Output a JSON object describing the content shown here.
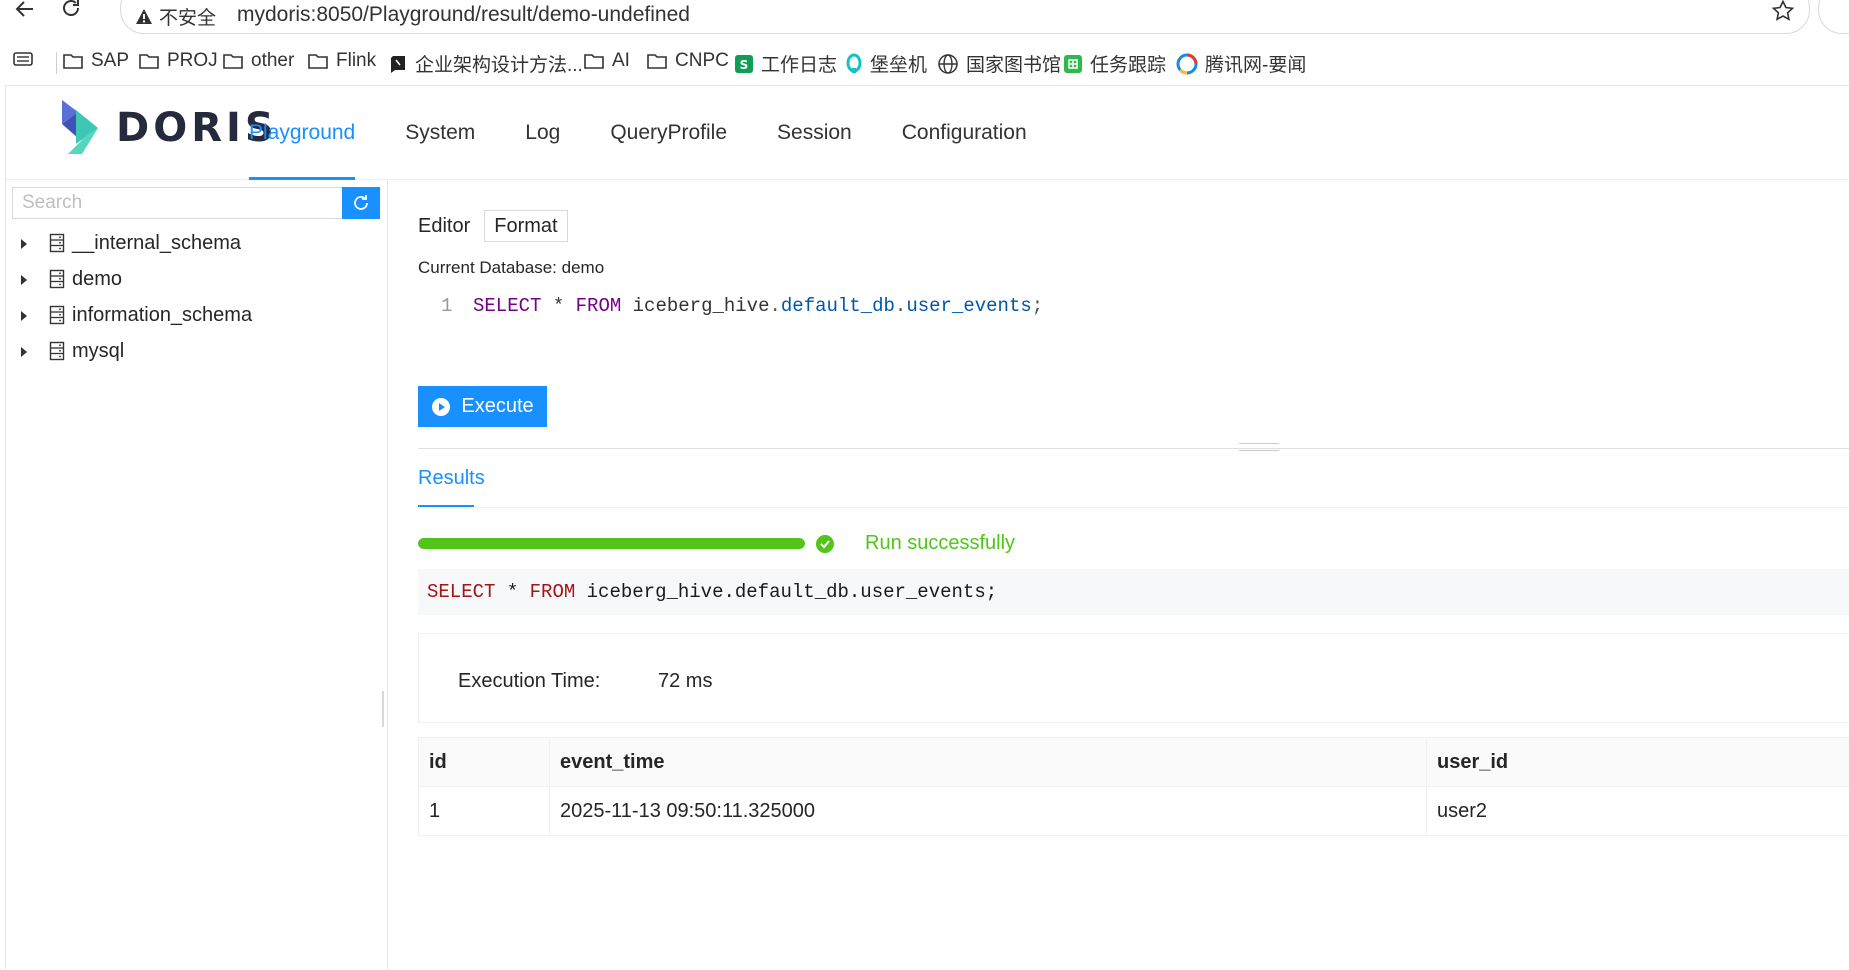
{
  "browser": {
    "security_label": "不安全",
    "url": "mydoris:8050/Playground/result/demo-undefined",
    "bookmarks": [
      {
        "label": "SAP",
        "icon": "folder-icon"
      },
      {
        "label": "PROJ",
        "icon": "folder-icon"
      },
      {
        "label": "other",
        "icon": "folder-icon"
      },
      {
        "label": "Flink",
        "icon": "folder-icon"
      },
      {
        "label": "企业架构设计方法...",
        "icon": "book-icon"
      },
      {
        "label": "AI",
        "icon": "folder-icon"
      },
      {
        "label": "CNPC",
        "icon": "folder-icon"
      },
      {
        "label": "工作日志",
        "icon": "sheet-icon"
      },
      {
        "label": "堡垒机",
        "icon": "bastion-icon"
      },
      {
        "label": "国家图书馆",
        "icon": "globe-icon"
      },
      {
        "label": "任务跟踪",
        "icon": "table-icon"
      },
      {
        "label": "腾讯网-要闻",
        "icon": "news-icon"
      }
    ]
  },
  "app": {
    "logo_text": "DORIS",
    "menu": [
      "Playground",
      "System",
      "Log",
      "QueryProfile",
      "Session",
      "Configuration"
    ],
    "active_menu": "Playground"
  },
  "sidebar": {
    "search_placeholder": "Search",
    "databases": [
      "__internal_schema",
      "demo",
      "information_schema",
      "mysql"
    ]
  },
  "editor": {
    "tab_editor": "Editor",
    "tab_format": "Format",
    "current_database": "Current Database: demo",
    "line_number": "1",
    "code": {
      "kw_select": "SELECT",
      "star": " * ",
      "kw_from": "FROM",
      "catalog": " iceberg_hive",
      "dot1": ".",
      "db": "default_db",
      "dot2": ".",
      "table": "user_events",
      "semi": ";"
    },
    "execute_label": "Execute"
  },
  "results": {
    "tab_label": "Results",
    "progress_percent": 100,
    "status_text": "Run successfully",
    "sql": {
      "kw_select": "SELECT",
      "star": " * ",
      "kw_from": "FROM",
      "rest": " iceberg_hive.default_db.user_events;"
    },
    "execution_time_label": "Execution Time:",
    "execution_time_value": "72 ms",
    "columns": [
      "id",
      "event_time",
      "user_id"
    ],
    "rows": [
      [
        "1",
        "2025-11-13 09:50:11.325000",
        "user2"
      ]
    ]
  },
  "colors": {
    "accent": "#1890ff",
    "success": "#52c41a"
  }
}
